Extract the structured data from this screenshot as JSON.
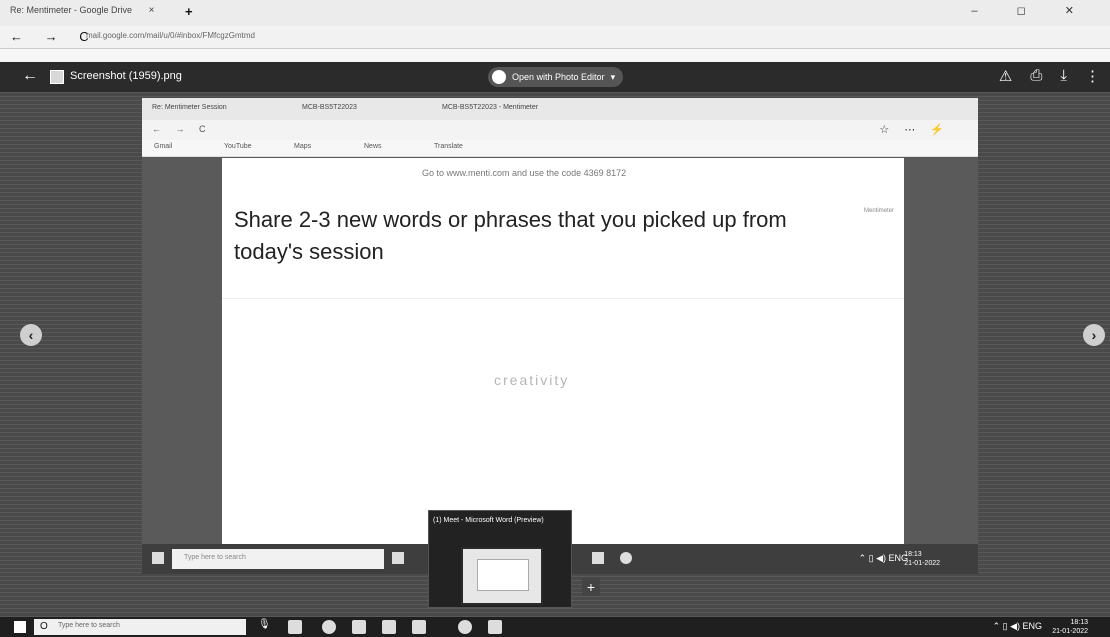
{
  "outer_browser": {
    "tab_title": "Re: Mentimeter - Google Drive",
    "tab_close": "×",
    "new_tab": "+",
    "window_controls": "– ◻ ✕",
    "nav_icons": "← → C",
    "url": "mail.google.com/mail/u/0/#inbox/FMfcgzGmtmd"
  },
  "viewer": {
    "back_icon": "←",
    "filename": "Screenshot (1959).png",
    "open_with": "Open with Photo Editor",
    "open_with_caret": "▾",
    "icons": [
      "⚠",
      "⎙",
      "⤓",
      "⋮"
    ]
  },
  "nav": {
    "prev": "‹",
    "next": "›"
  },
  "inner_browser": {
    "tabs": [
      "Re: Mentimeter Session",
      "MCB-BS5T22023",
      "MCB-BS5T22023 - Mentimeter"
    ],
    "nav_icons": "← → C",
    "ext_icons": "☆ ⋯ ⚡",
    "bookmarks": [
      "Gmail",
      "YouTube",
      "Maps",
      "News",
      "Translate"
    ]
  },
  "slide": {
    "goto_text": "Go to www.menti.com and use the code 4369 8172",
    "question": "Share 2-3 new words or phrases that you picked up from today's session",
    "side_note": "Mentimeter",
    "word_cloud": [
      "creativity"
    ],
    "menu": "⋮"
  },
  "inner_taskbar": {
    "search_placeholder": "Type here to search",
    "tray": "⌃ ▯ ◀) ENG",
    "time": "18:13",
    "date": "21-01-2022"
  },
  "popup": {
    "title": "(1) Meet - Microsoft Word (Preview)",
    "plus": "+"
  },
  "taskbar": {
    "search_icon": "O",
    "search_placeholder": "Type here to search",
    "mic": "🎙",
    "tray": "⌃ ▯ ◀) ENG",
    "time": "18:13",
    "date": "21-01-2022"
  }
}
